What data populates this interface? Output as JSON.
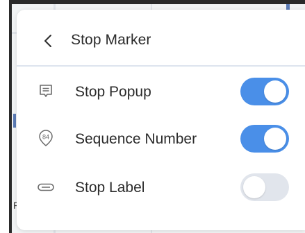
{
  "panel": {
    "title": "Stop Marker",
    "back_icon": "chevron-left-icon"
  },
  "rows": [
    {
      "label": "Stop Popup",
      "icon": "popup-icon",
      "enabled": true
    },
    {
      "label": "Sequence Number",
      "icon": "sequence-number-icon",
      "icon_text": "84",
      "enabled": true
    },
    {
      "label": "Stop Label",
      "icon": "label-tag-icon",
      "enabled": false
    }
  ],
  "map": {
    "edge_letter": "F"
  },
  "colors": {
    "toggle_on": "#4a8fe8",
    "toggle_off": "#e1e5ec",
    "divider": "#dde4ee",
    "text": "#2b2b2b",
    "icon": "#6b6b6b"
  }
}
